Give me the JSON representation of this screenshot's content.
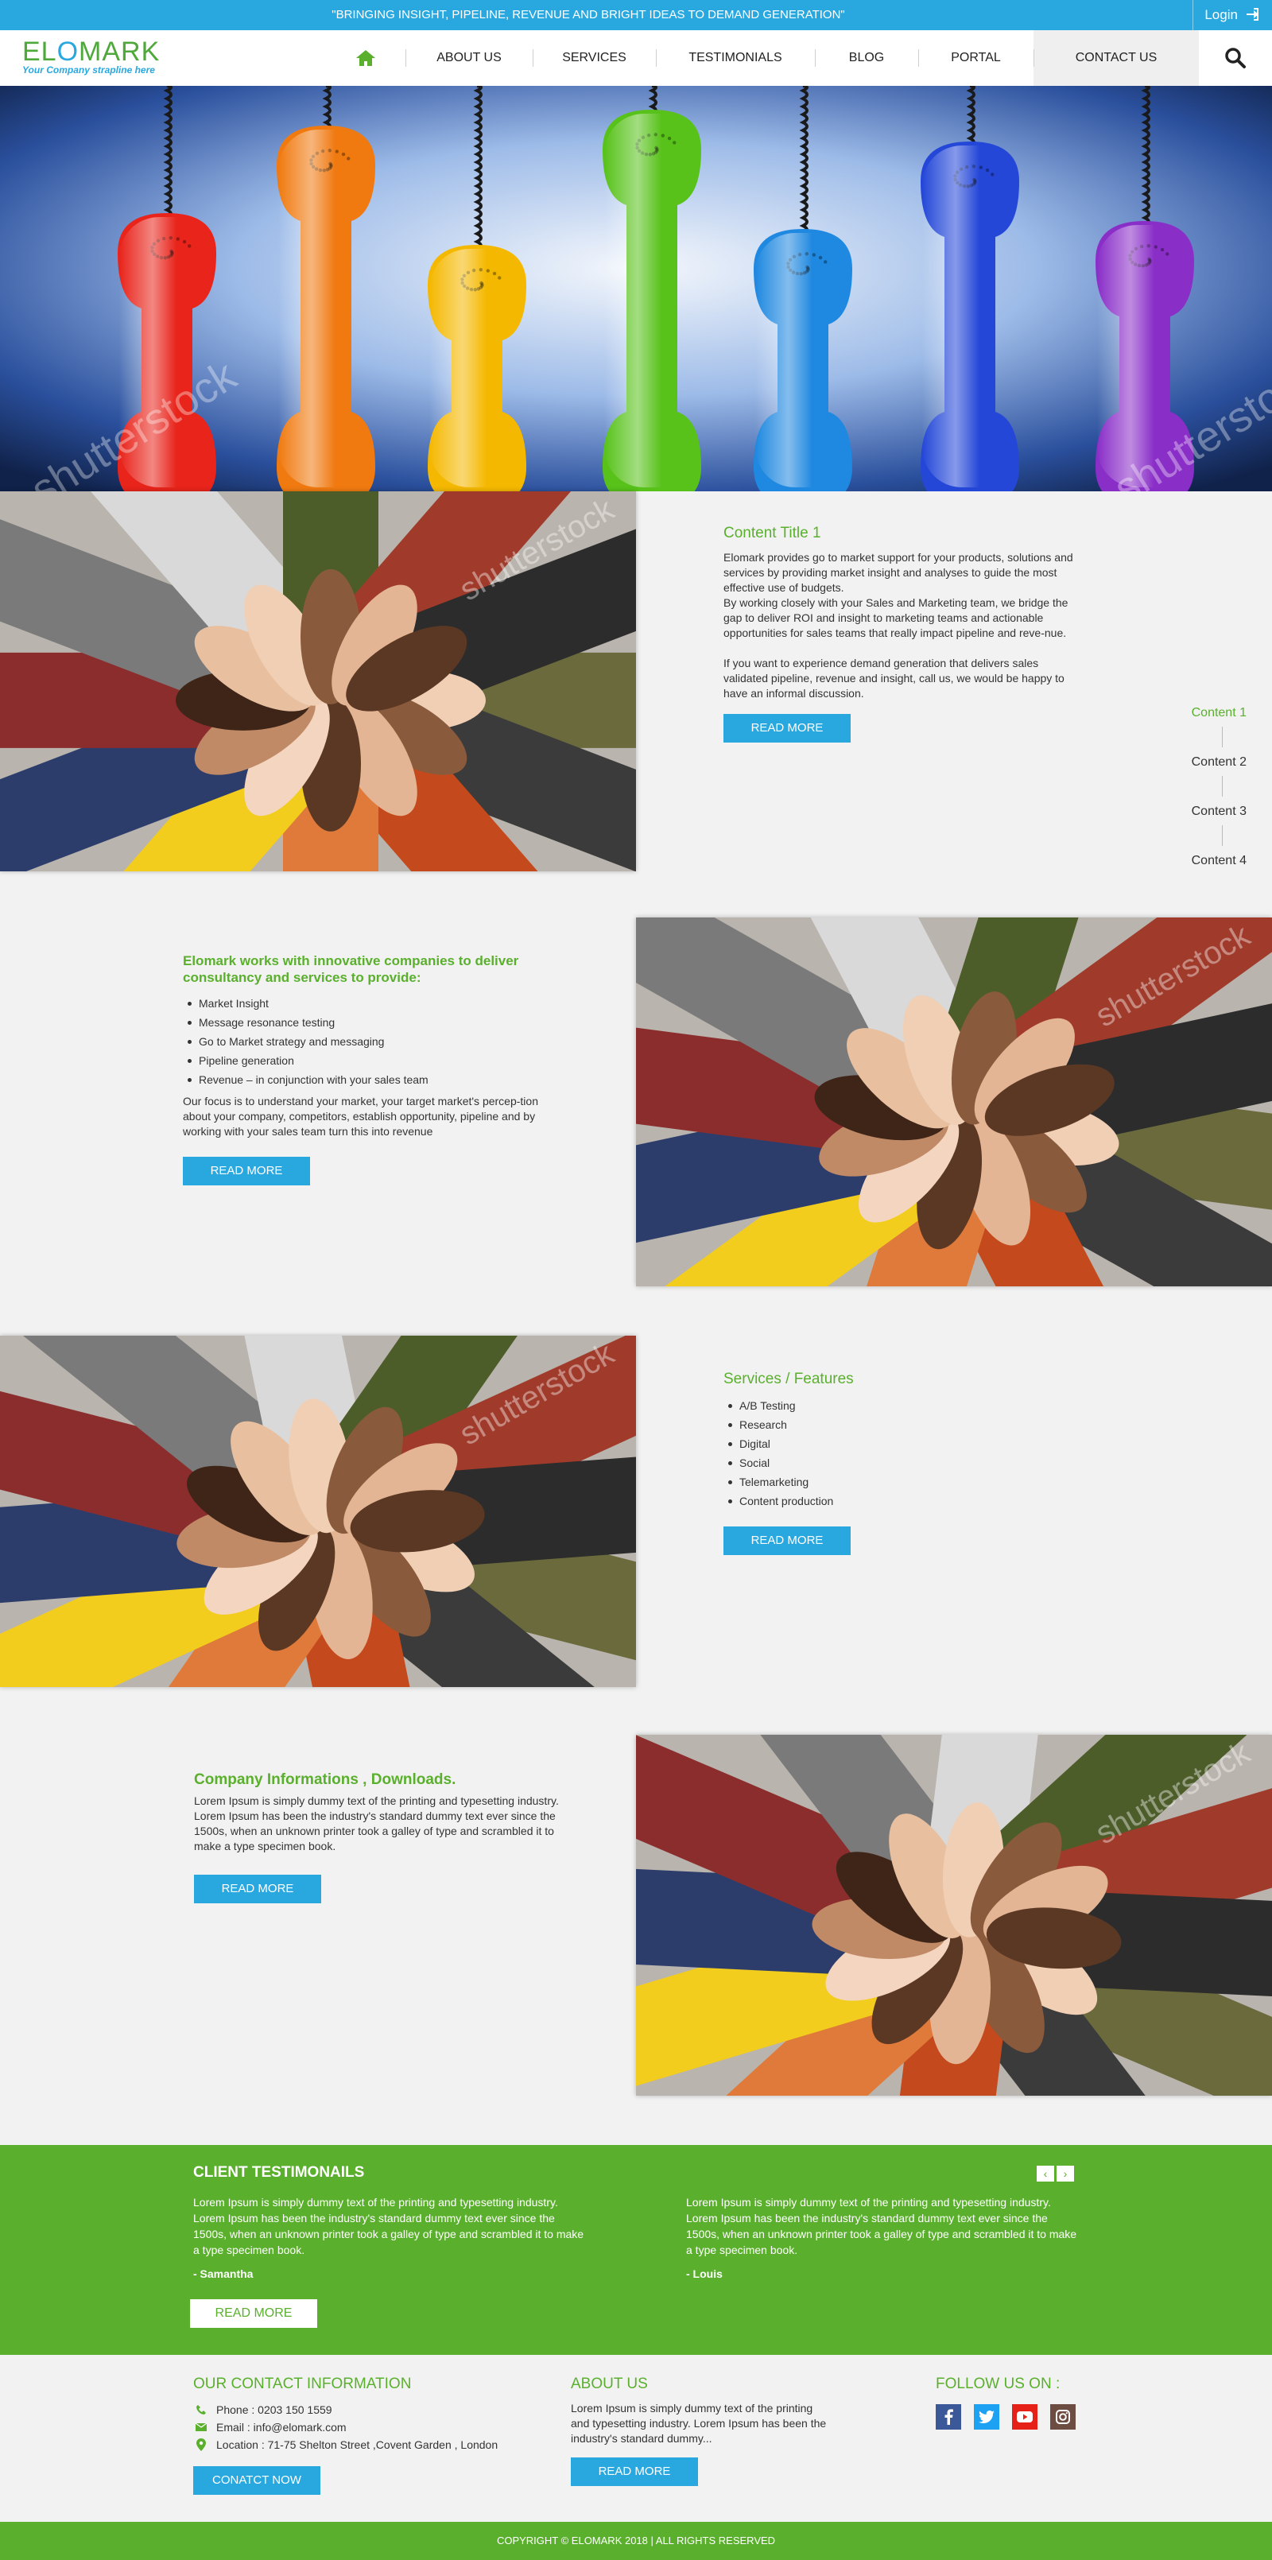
{
  "topbar": {
    "tagline": "\"BRINGING INSIGHT, PIPELINE, REVENUE AND BRIGHT IDEAS TO DEMAND GENERATION\"",
    "login_label": "Login"
  },
  "header": {
    "logo_text_a": "EL",
    "logo_text_b": "O",
    "logo_text_c": "MARK",
    "strapline": "Your Company strapline here",
    "nav": [
      {
        "label": "ABOUT US"
      },
      {
        "label": "SERVICES"
      },
      {
        "label": "TESTIMONIALS"
      },
      {
        "label": "BLOG"
      },
      {
        "label": "PORTAL"
      },
      {
        "label": "CONTACT US"
      }
    ]
  },
  "hero": {
    "watermark": "shutterstock",
    "phone_colors": [
      "#e8241b",
      "#f07a10",
      "#f5b800",
      "#58c21a",
      "#1f88e0",
      "#2447d8",
      "#8a2ec8"
    ]
  },
  "section1": {
    "title": "Content Title 1",
    "para1": "Elomark provides go to market support for your products, solutions and services by providing market insight and analyses to guide the most effective use of budgets.",
    "para2": "By working closely with your Sales and Marketing team, we bridge the gap to deliver ROI and insight to marketing teams and actionable opportunities for sales teams that really impact pipeline and reve-nue.",
    "para3": "If you want to experience demand generation that delivers sales validated pipeline, revenue and insight, call us, we would be happy to have an informal discussion.",
    "button": "READ MORE"
  },
  "sidenav": {
    "items": [
      "Content 1",
      "Content 2",
      "Content 3",
      "Content 4"
    ]
  },
  "section2": {
    "title": "Elomark works with innovative companies to deliver consultancy and services to provide:",
    "bullets": [
      "Market Insight",
      "Message resonance testing",
      "Go to Market strategy and messaging",
      "Pipeline generation",
      "Revenue – in conjunction with your sales team"
    ],
    "para": "Our focus is to understand your market, your target market's percep-tion about your company, competitors, establish opportunity, pipeline and by working with your sales team turn this into revenue",
    "button": "READ MORE"
  },
  "section3": {
    "title": "Services / Features",
    "bullets": [
      "A/B Testing",
      "Research",
      "Digital",
      "Social",
      "Telemarketing",
      "Content production"
    ],
    "button": "READ MORE"
  },
  "section4": {
    "title": "Company Informations , Downloads.",
    "para": "Lorem Ipsum is simply dummy text of the printing and typesetting industry. Lorem Ipsum has been the industry's standard dummy text ever since the 1500s, when an unknown printer took a galley of type and scrambled it to make a type specimen book.",
    "button": "READ MORE"
  },
  "testimonials": {
    "title": "CLIENT TESTIMONAILS",
    "prev": "‹",
    "next": "›",
    "items": [
      {
        "text": "Lorem Ipsum is simply dummy text of the printing and typesetting industry. Lorem Ipsum has been the industry's standard dummy text ever since the 1500s, when an unknown printer took a galley of type and scrambled it to make a type specimen book.",
        "author": "- Samantha"
      },
      {
        "text": "Lorem Ipsum is simply dummy text of the printing and typesetting industry. Lorem Ipsum has been the industry's standard dummy text ever since the 1500s, when an unknown printer took a galley of type and scrambled it to make a type specimen book.",
        "author": "- Louis"
      }
    ],
    "button": "READ MORE"
  },
  "footer": {
    "contact_title": "OUR CONTACT INFORMATION",
    "phone": "Phone : 0203 150 1559",
    "email": "Email : info@elomark.com",
    "location": "Location : 71-75 Shelton Street ,Covent Garden , London",
    "contact_button": "CONATCT NOW",
    "about_title": "ABOUT US",
    "about_text": "Lorem Ipsum is simply dummy text of the printing and typesetting industry. Lorem Ipsum has been the industry's standard dummy...",
    "about_button": "READ MORE",
    "follow_title": "FOLLOW US ON :",
    "social": [
      {
        "icon": "facebook-icon",
        "color": "#3b5998"
      },
      {
        "icon": "twitter-icon",
        "color": "#1da1f2"
      },
      {
        "icon": "youtube-icon",
        "color": "#e62117"
      },
      {
        "icon": "instagram-icon",
        "color": "#6d4c41"
      }
    ],
    "copyright": "COPYRIGHT © ELOMARK 2018 | ALL RIGHTS RESERVED"
  }
}
